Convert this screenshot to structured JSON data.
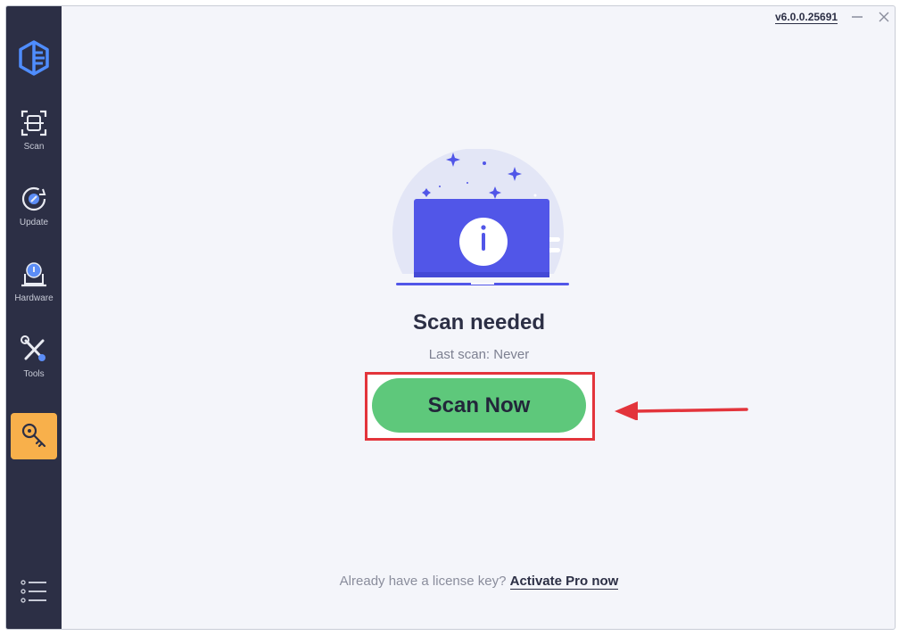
{
  "app": {
    "version": "v6.0.0.25691"
  },
  "sidebar": {
    "items": [
      {
        "label": "Scan",
        "icon": "scan-icon"
      },
      {
        "label": "Update",
        "icon": "update-icon"
      },
      {
        "label": "Hardware",
        "icon": "hardware-icon"
      },
      {
        "label": "Tools",
        "icon": "tools-icon"
      }
    ],
    "active_icon": "key-icon",
    "menu_icon": "menu-list-icon"
  },
  "main": {
    "title": "Scan needed",
    "subtitle": "Last scan: Never",
    "scan_button_label": "Scan Now",
    "footer_prefix": "Already have a license key?",
    "footer_link": "Activate Pro now"
  },
  "colors": {
    "sidebar_bg": "#2c2f45",
    "accent_orange": "#f8b04b",
    "scan_green": "#5ec87b",
    "illustration_blue": "#5156e8",
    "highlight_red": "#e3343b"
  }
}
